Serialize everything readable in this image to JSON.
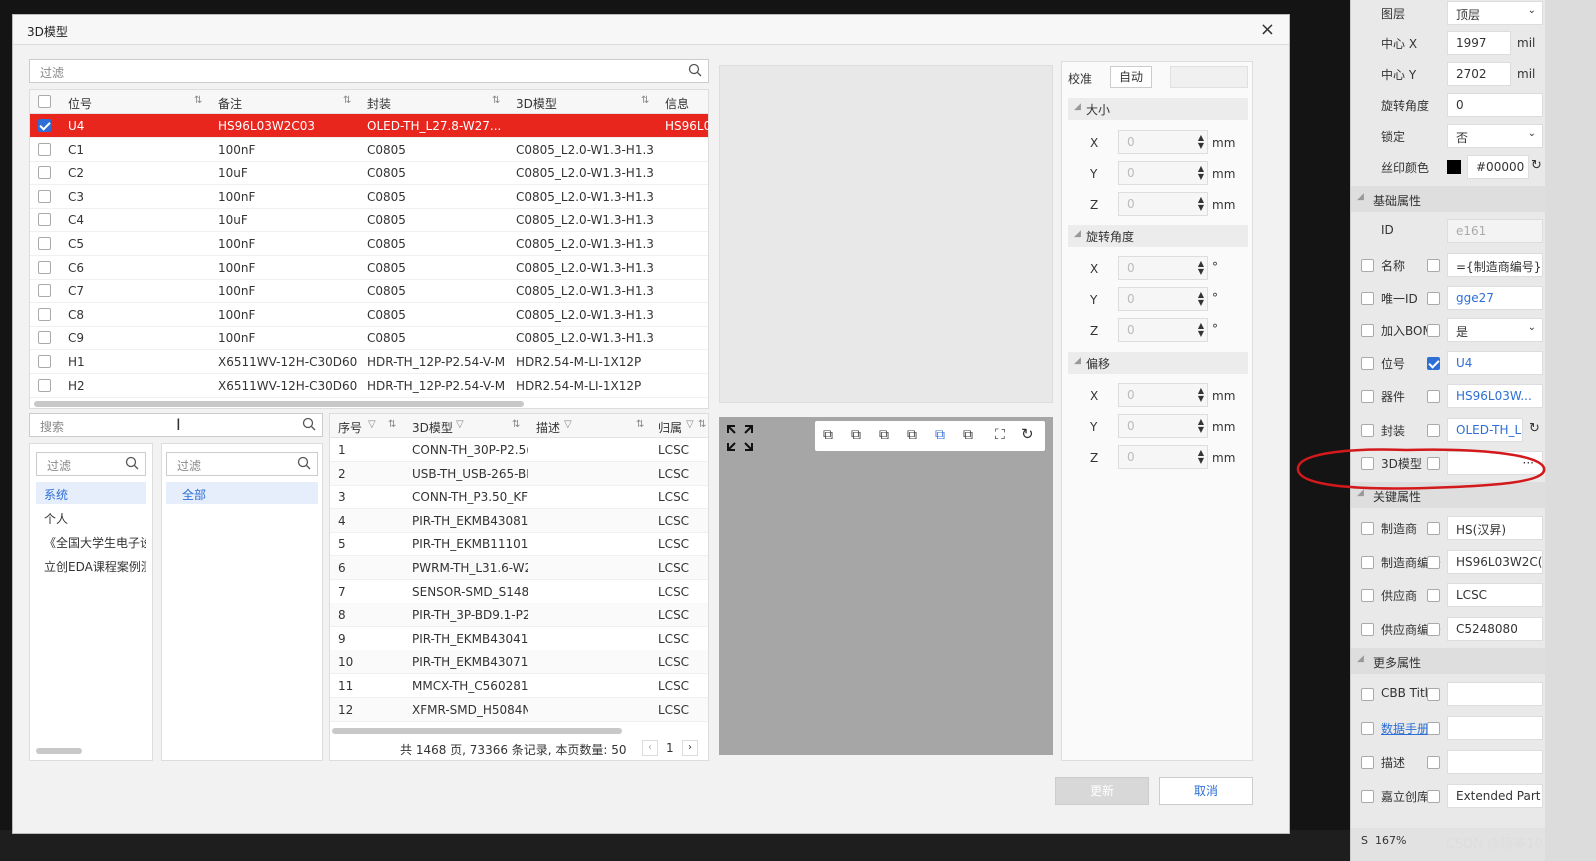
{
  "dialog": {
    "title": "3D模型"
  },
  "top_filter": {
    "placeholder": "过滤"
  },
  "main_table": {
    "headers": [
      "位号",
      "备注",
      "封装",
      "3D模型",
      "信息"
    ],
    "rows": [
      {
        "checked": true,
        "selected": true,
        "ref": "U4",
        "note": "HS96L03W2C03",
        "footprint": "OLED-TH_L27.8-W27...",
        "model": "",
        "info": "HS96L0"
      },
      {
        "checked": false,
        "selected": false,
        "ref": "C1",
        "note": "100nF",
        "footprint": "C0805",
        "model": "C0805_L2.0-W1.3-H1.3",
        "info": ""
      },
      {
        "checked": false,
        "selected": false,
        "ref": "C2",
        "note": "10uF",
        "footprint": "C0805",
        "model": "C0805_L2.0-W1.3-H1.3",
        "info": ""
      },
      {
        "checked": false,
        "selected": false,
        "ref": "C3",
        "note": "100nF",
        "footprint": "C0805",
        "model": "C0805_L2.0-W1.3-H1.3",
        "info": ""
      },
      {
        "checked": false,
        "selected": false,
        "ref": "C4",
        "note": "10uF",
        "footprint": "C0805",
        "model": "C0805_L2.0-W1.3-H1.3",
        "info": ""
      },
      {
        "checked": false,
        "selected": false,
        "ref": "C5",
        "note": "100nF",
        "footprint": "C0805",
        "model": "C0805_L2.0-W1.3-H1.3",
        "info": ""
      },
      {
        "checked": false,
        "selected": false,
        "ref": "C6",
        "note": "100nF",
        "footprint": "C0805",
        "model": "C0805_L2.0-W1.3-H1.3",
        "info": ""
      },
      {
        "checked": false,
        "selected": false,
        "ref": "C7",
        "note": "100nF",
        "footprint": "C0805",
        "model": "C0805_L2.0-W1.3-H1.3",
        "info": ""
      },
      {
        "checked": false,
        "selected": false,
        "ref": "C8",
        "note": "100nF",
        "footprint": "C0805",
        "model": "C0805_L2.0-W1.3-H1.3",
        "info": ""
      },
      {
        "checked": false,
        "selected": false,
        "ref": "C9",
        "note": "100nF",
        "footprint": "C0805",
        "model": "C0805_L2.0-W1.3-H1.3",
        "info": ""
      },
      {
        "checked": false,
        "selected": false,
        "ref": "H1",
        "note": "X6511WV-12H-C30D60",
        "footprint": "HDR-TH_12P-P2.54-V-M",
        "model": "HDR2.54-M-LI-1X12P",
        "info": ""
      },
      {
        "checked": false,
        "selected": false,
        "ref": "H2",
        "note": "X6511WV-12H-C30D60",
        "footprint": "HDR-TH_12P-P2.54-V-M",
        "model": "HDR2.54-M-LI-1X12P",
        "info": ""
      }
    ]
  },
  "search": {
    "placeholder": "搜索"
  },
  "lib_filter": {
    "placeholder": "过滤"
  },
  "lib_list": [
    "系统",
    "个人",
    "《全国大学生电子设",
    "立创EDA课程案例测"
  ],
  "cat_filter": {
    "placeholder": "过滤"
  },
  "cat_list": [
    "全部"
  ],
  "model_table": {
    "headers": [
      "序号",
      "3D模型",
      "描述",
      "归属"
    ],
    "rows": [
      {
        "no": "1",
        "model": "CONN-TH_30P-P2.5(",
        "desc": "",
        "owner": "LCSC"
      },
      {
        "no": "2",
        "model": "USB-TH_USB-265-BF",
        "desc": "",
        "owner": "LCSC"
      },
      {
        "no": "3",
        "model": "CONN-TH_P3.50_KF",
        "desc": "",
        "owner": "LCSC"
      },
      {
        "no": "4",
        "model": "PIR-TH_EKMB43081'",
        "desc": "",
        "owner": "LCSC"
      },
      {
        "no": "5",
        "model": "PIR-TH_EKMB111011",
        "desc": "",
        "owner": "LCSC"
      },
      {
        "no": "6",
        "model": "PWRM-TH_L31.6-W2",
        "desc": "",
        "owner": "LCSC"
      },
      {
        "no": "7",
        "model": "SENSOR-SMD_S148",
        "desc": "",
        "owner": "LCSC"
      },
      {
        "no": "8",
        "model": "PIR-TH_3P-BD9.1-P2",
        "desc": "",
        "owner": "LCSC"
      },
      {
        "no": "9",
        "model": "PIR-TH_EKMB43041'",
        "desc": "",
        "owner": "LCSC"
      },
      {
        "no": "10",
        "model": "PIR-TH_EKMB43071'",
        "desc": "",
        "owner": "LCSC"
      },
      {
        "no": "11",
        "model": "MMCX-TH_C5602818",
        "desc": "",
        "owner": "LCSC"
      },
      {
        "no": "12",
        "model": "XFMR-SMD_H5084N",
        "desc": "",
        "owner": "LCSC"
      }
    ],
    "pager_text": "共 1468 页, 73366 条记录, 本页数量: 50",
    "page": "1"
  },
  "calib": {
    "label": "校准",
    "auto": "自动"
  },
  "size": {
    "title": "大小",
    "x": "0",
    "y": "0",
    "z": "0",
    "unit": "mm"
  },
  "rotation": {
    "title": "旋转角度",
    "x": "0",
    "y": "0",
    "z": "0",
    "unit": "°"
  },
  "offset": {
    "title": "偏移",
    "x": "0",
    "y": "0",
    "z": "0",
    "unit": "mm"
  },
  "axes": [
    "X",
    "Y",
    "Z"
  ],
  "buttons": {
    "update": "更新",
    "cancel": "取消"
  },
  "props": {
    "layer": {
      "label": "图层",
      "value": "顶层"
    },
    "cx": {
      "label": "中心 X",
      "value": "1997",
      "unit": "mil"
    },
    "cy": {
      "label": "中心 Y",
      "value": "2702",
      "unit": "mil"
    },
    "rot": {
      "label": "旋转角度",
      "value": "0"
    },
    "lock": {
      "label": "锁定",
      "value": "否"
    },
    "silk": {
      "label": "丝印颜色",
      "value": "#00000"
    },
    "basic": "基础属性",
    "id": {
      "label": "ID",
      "value": "e161"
    },
    "name": {
      "label": "名称",
      "value": "={制造商编号}"
    },
    "uid": {
      "label": "唯一ID",
      "value": "gge27"
    },
    "bom": {
      "label": "加入BOM",
      "value": "是"
    },
    "ref": {
      "label": "位号",
      "value": "U4"
    },
    "device": {
      "label": "器件",
      "value": "HS96L03W..."
    },
    "fp": {
      "label": "封装",
      "value": "OLED-TH_L"
    },
    "model3d": {
      "label": "3D模型",
      "value": "···"
    },
    "key": "关键属性",
    "mfr": {
      "label": "制造商",
      "value": "HS(汉昇)"
    },
    "mpn": {
      "label": "制造商编号",
      "value": "HS96L03W2C("
    },
    "supplier": {
      "label": "供应商",
      "value": "LCSC"
    },
    "spn": {
      "label": "供应商编号",
      "value": "C5248080"
    },
    "more": "更多属性",
    "cbb": {
      "label": "CBB Title",
      "value": ""
    },
    "datasheet": {
      "label": "数据手册",
      "value": ""
    },
    "desc": {
      "label": "描述",
      "value": ""
    },
    "jlc": {
      "label": "嘉立创库...",
      "value": "Extended Part"
    }
  },
  "status": {
    "zoom": "167%",
    "watermark": "CSDN @楠筝107"
  }
}
